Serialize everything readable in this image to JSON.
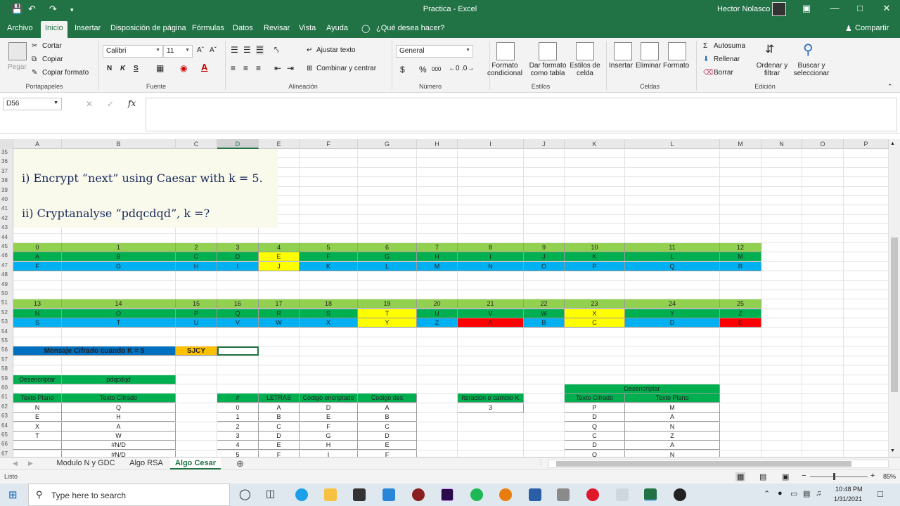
{
  "window": {
    "title": "Practica - Excel",
    "user": "Hector Nolasco"
  },
  "ribbon_tabs": [
    "Archivo",
    "Inicio",
    "Insertar",
    "Disposición de página",
    "Fórmulas",
    "Datos",
    "Revisar",
    "Vista",
    "Ayuda",
    "¿Qué desea hacer?"
  ],
  "share": "Compartir",
  "clipboard": {
    "paste": "Pegar",
    "cut": "Cortar",
    "copy": "Copiar",
    "format_painter": "Copiar formato",
    "label": "Portapapeles"
  },
  "font": {
    "name": "Calibri",
    "size": "11",
    "label": "Fuente",
    "bold": "N",
    "italic": "K",
    "underline": "S"
  },
  "alignment": {
    "wrap": "Ajustar texto",
    "merge": "Combinar y centrar",
    "label": "Alineación"
  },
  "number": {
    "format": "General",
    "label": "Número",
    "currency": "$",
    "percent": "%",
    "thousands": "000"
  },
  "styles": {
    "cond": "Formato condicional",
    "table": "Dar formato como tabla",
    "cell": "Estilos de celda",
    "label": "Estilos"
  },
  "cells": {
    "insert": "Insertar",
    "delete": "Eliminar",
    "format": "Formato",
    "label": "Celdas"
  },
  "editing": {
    "autosum": "Autosuma",
    "fill": "Rellenar",
    "clear": "Borrar",
    "sort": "Ordenar y filtrar",
    "find": "Buscar y seleccionar",
    "label": "Edición"
  },
  "formula_bar": {
    "namebox": "D56",
    "fx": "fx",
    "value": ""
  },
  "columns": [
    "A",
    "B",
    "C",
    "D",
    "E",
    "F",
    "G",
    "H",
    "I",
    "J",
    "K",
    "L",
    "M",
    "N",
    "O",
    "P"
  ],
  "rows": [
    35,
    36,
    37,
    38,
    39,
    40,
    41,
    42,
    43,
    44,
    45,
    46,
    47,
    48,
    49,
    50,
    51,
    52,
    53,
    54,
    55,
    56,
    57,
    58,
    59,
    60,
    61,
    62,
    63,
    64,
    65,
    66,
    67
  ],
  "overlay": {
    "line1": "i)  Encrypt “next” using Caesar with k = 5.",
    "line2": "ii)  Cryptanalyse “pdqcdqd”, k =?"
  },
  "table1": {
    "nums": [
      "0",
      "1",
      "2",
      "3",
      "4",
      "5",
      "6",
      "7",
      "8",
      "9",
      "10",
      "11",
      "12"
    ],
    "plain": [
      "A",
      "B",
      "C",
      "D",
      "E",
      "F",
      "G",
      "H",
      "I",
      "J",
      "K",
      "L",
      "M"
    ],
    "cipher": [
      "F",
      "G",
      "H",
      "I",
      "J",
      "K",
      "L",
      "M",
      "N",
      "O",
      "P",
      "Q",
      "R"
    ]
  },
  "table2": {
    "nums": [
      "13",
      "14",
      "15",
      "16",
      "17",
      "18",
      "19",
      "20",
      "21",
      "22",
      "23",
      "24",
      "25"
    ],
    "plain": [
      "N",
      "O",
      "P",
      "Q",
      "R",
      "S",
      "T",
      "U",
      "V",
      "W",
      "X",
      "Y",
      "Z"
    ],
    "cipher": [
      "S",
      "T",
      "U",
      "V",
      "W",
      "X",
      "Y",
      "Z",
      "A",
      "B",
      "C",
      "D",
      "E"
    ]
  },
  "cifrado": {
    "label": "Mensaje Cifrado cuando K = 5",
    "value": "SJCY"
  },
  "desencriptar": {
    "label": "Desencriptar",
    "value": "pdqcdqd"
  },
  "plain_table": {
    "h1": "Texto Plano",
    "h2": "Texto Cifrado",
    "rows": [
      [
        "N",
        "Q"
      ],
      [
        "E",
        "H"
      ],
      [
        "X",
        "A"
      ],
      [
        "T",
        "W"
      ],
      [
        "",
        "#N/D"
      ],
      [
        "",
        "#N/D"
      ]
    ]
  },
  "letras_table": {
    "headers": [
      "#",
      "LETRAS",
      "Codigo encriptado",
      "Codigo des"
    ],
    "rows": [
      [
        "0",
        "A",
        "D",
        "A"
      ],
      [
        "1",
        "B",
        "E",
        "B"
      ],
      [
        "2",
        "C",
        "F",
        "C"
      ],
      [
        "3",
        "D",
        "G",
        "D"
      ],
      [
        "4",
        "E",
        "H",
        "E"
      ],
      [
        "5",
        "F",
        "I",
        "F"
      ]
    ]
  },
  "iteracion": {
    "label": "Iteracion o cambio K",
    "value": "3"
  },
  "decrypt_table": {
    "title": "Desencriptar",
    "h1": "Texto Cifrado",
    "h2": "Texto Plano",
    "rows": [
      [
        "P",
        "M"
      ],
      [
        "D",
        "A"
      ],
      [
        "Q",
        "N"
      ],
      [
        "C",
        "Z"
      ],
      [
        "D",
        "A"
      ],
      [
        "Q",
        "N"
      ]
    ]
  },
  "sheets": [
    "Modulo N y GDC",
    "Algo RSA",
    "Algo Cesar"
  ],
  "status": {
    "text": "Listo",
    "zoom": "85%"
  },
  "taskbar": {
    "search": "Type here to search",
    "time": "10:48 PM",
    "date": "1/31/2021"
  },
  "colors": {
    "green": "#92d050",
    "green2": "#00b050",
    "blue": "#00b0f0",
    "yellow": "#ffff00",
    "red": "#ff0000",
    "navy": "#0070c0",
    "orange": "#ffc000",
    "excel": "#217346"
  }
}
